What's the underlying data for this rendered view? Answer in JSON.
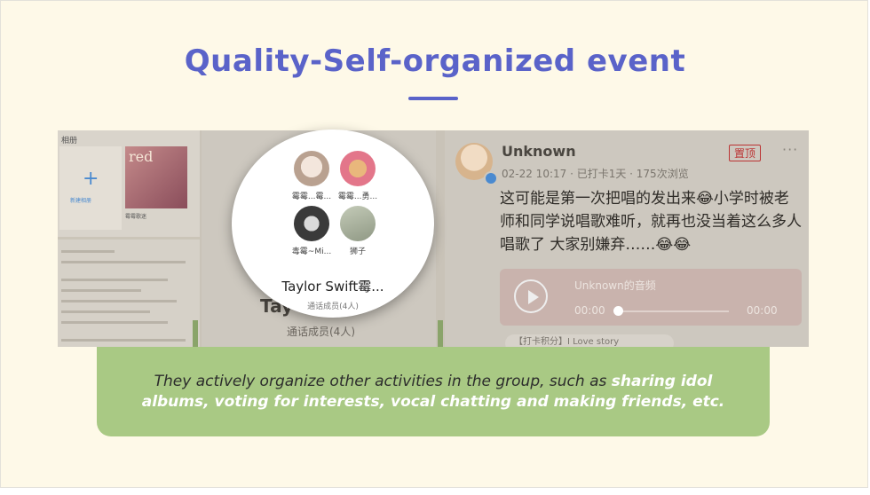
{
  "slide": {
    "title": "Quality-Self-organized event",
    "caption_plain": "They actively organize other activities in the group, such as ",
    "caption_bold": "sharing idol albums, voting for interests, vocal chatting and making friends, etc."
  },
  "screenshot_album": {
    "header": "相册",
    "new_album_label": "新建相册",
    "album_title": "霉霉歌迷"
  },
  "screenshot_call": {
    "members": [
      {
        "name": "霉霉...霉..."
      },
      {
        "name": "霉霉...勇..."
      },
      {
        "name": "毒霉~Mi..."
      },
      {
        "name": "狮子"
      }
    ],
    "group_name": "Taylor Swift霉...",
    "member_count": "通话成员(4人)",
    "background_count": "通话成员(4人)",
    "background_name": "Tay"
  },
  "screenshot_post": {
    "username": "Unknown",
    "meta": "02-22 10:17 · 已打卡1天 · 175次浏览",
    "pin_label": "置顶",
    "more_icon": "more-icon",
    "content": "这可能是第一次把唱的发出来😂小学时被老师和同学说唱歌难听，就再也没当着这么多人唱歌了 大家别嫌弃……😂😂",
    "audio_title": "Unknown的音频",
    "time_current": "00:00",
    "time_total": "00:00",
    "tag": "【打卡积分】I Love story"
  },
  "colors": {
    "background": "#fef9e8",
    "title": "#5a63c9",
    "caption_box": "#a9c984",
    "caption_bold": "#ffffff"
  }
}
